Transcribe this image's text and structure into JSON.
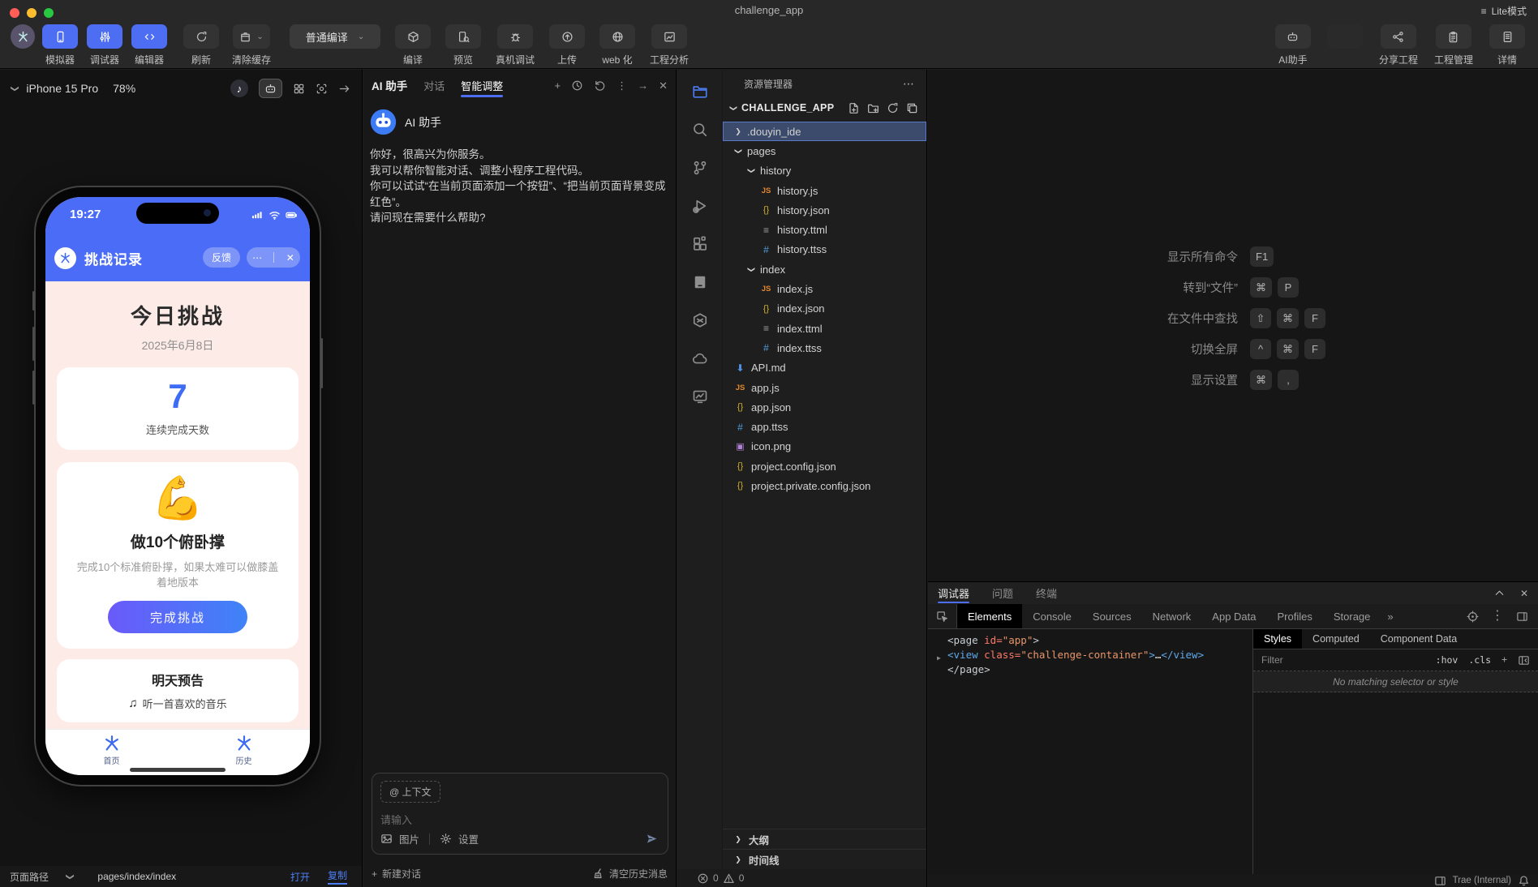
{
  "window": {
    "title": "challenge_app",
    "lite_mode": "Lite模式"
  },
  "toolbar": {
    "primary": [
      {
        "label": "模拟器",
        "icon": "phone"
      },
      {
        "label": "调试器",
        "icon": "sliders"
      },
      {
        "label": "编辑器",
        "icon": "code"
      }
    ],
    "secondary": [
      {
        "label": "刷新",
        "icon": "refresh",
        "caret": false
      },
      {
        "label": "清除缓存",
        "icon": "clear",
        "caret": true
      }
    ],
    "compile_select": "普通编译",
    "actions": [
      {
        "label": "编译",
        "icon": "box"
      },
      {
        "label": "预览",
        "icon": "preview"
      },
      {
        "label": "真机调试",
        "icon": "bug"
      },
      {
        "label": "上传",
        "icon": "upload"
      },
      {
        "label": "web 化",
        "icon": "globe"
      },
      {
        "label": "工程分析",
        "icon": "analysis"
      }
    ],
    "right_actions": [
      {
        "label": "AI助手",
        "icon": "robot",
        "disabled": false
      },
      {
        "label": "",
        "icon": "blank",
        "disabled": true
      },
      {
        "label": "分享工程",
        "icon": "share",
        "disabled": false
      },
      {
        "label": "工程管理",
        "icon": "clipboard",
        "disabled": false
      },
      {
        "label": "详情",
        "icon": "doc",
        "disabled": false
      }
    ]
  },
  "simulator": {
    "device": "iPhone 15 Pro",
    "zoom": "78%",
    "footer": {
      "label": "页面路径",
      "path": "pages/index/index",
      "open": "打开",
      "copy": "复制"
    },
    "phone": {
      "time": "19:27",
      "app_title": "挑战记录",
      "feedback": "反馈",
      "heading": "今日挑战",
      "date": "2025年6月8日",
      "streak_value": "7",
      "streak_label": "连续完成天数",
      "challenge_emoji": "💪",
      "challenge_title": "做10个俯卧撑",
      "challenge_desc": "完成10个标准俯卧撑，如果太难可以做膝盖着地版本",
      "complete_button": "完成挑战",
      "tomorrow_title": "明天预告",
      "tomorrow_desc": "听一首喜欢的音乐",
      "tabs": [
        {
          "label": "首页"
        },
        {
          "label": "历史"
        }
      ]
    }
  },
  "ai_panel": {
    "title": "AI 助手",
    "tab_chat": "对话",
    "tab_smart": "智能调整",
    "assistant_name": "AI 助手",
    "message": "你好，很高兴为你服务。\n我可以帮你智能对话、调整小程序工程代码。\n你可以试试“在当前页面添加一个按钮”、“把当前页面背景变成红色”。\n请问现在需要什么帮助?",
    "context_chip": "@ 上下文",
    "input_placeholder": "请输入",
    "image_button": "图片",
    "settings_button": "设置",
    "new_chat": "新建对话",
    "clear_history": "清空历史消息"
  },
  "explorer": {
    "title": "资源管理器",
    "project": "CHALLENGE_APP",
    "activity_bar": [
      "files",
      "search",
      "source-control",
      "run-debug",
      "extensions",
      "notebook",
      "package",
      "cloud",
      "monitor"
    ],
    "tree": [
      {
        "level": 1,
        "kind": "folder",
        "chevron": "right",
        "label": ".douyin_ide",
        "selected": true
      },
      {
        "level": 1,
        "kind": "folder",
        "chevron": "down",
        "label": "pages",
        "selected": false
      },
      {
        "level": 2,
        "kind": "folder",
        "chevron": "down",
        "label": "history",
        "selected": false
      },
      {
        "level": 3,
        "kind": "js",
        "label": "history.js",
        "selected": false
      },
      {
        "level": 3,
        "kind": "json",
        "label": "history.json",
        "selected": false
      },
      {
        "level": 3,
        "kind": "ttml",
        "label": "history.ttml",
        "selected": false
      },
      {
        "level": 3,
        "kind": "ttss",
        "label": "history.ttss",
        "selected": false
      },
      {
        "level": 2,
        "kind": "folder",
        "chevron": "down",
        "label": "index",
        "selected": false
      },
      {
        "level": 3,
        "kind": "js",
        "label": "index.js",
        "selected": false
      },
      {
        "level": 3,
        "kind": "json",
        "label": "index.json",
        "selected": false
      },
      {
        "level": 3,
        "kind": "ttml",
        "label": "index.ttml",
        "selected": false
      },
      {
        "level": 3,
        "kind": "ttss",
        "label": "index.ttss",
        "selected": false
      },
      {
        "level": 1,
        "kind": "md",
        "label": "API.md",
        "selected": false
      },
      {
        "level": 1,
        "kind": "js",
        "label": "app.js",
        "selected": false
      },
      {
        "level": 1,
        "kind": "json",
        "label": "app.json",
        "selected": false
      },
      {
        "level": 1,
        "kind": "ttss",
        "label": "app.ttss",
        "selected": false
      },
      {
        "level": 1,
        "kind": "img",
        "label": "icon.png",
        "selected": false
      },
      {
        "level": 1,
        "kind": "json",
        "label": "project.config.json",
        "selected": false
      },
      {
        "level": 1,
        "kind": "json",
        "label": "project.private.config.json",
        "selected": false
      }
    ],
    "outline": "大纲",
    "timeline": "时间线"
  },
  "editor": {
    "shortcuts": [
      {
        "label": "显示所有命令",
        "keys": [
          "F1"
        ]
      },
      {
        "label": "转到“文件”",
        "keys": [
          "⌘",
          "P"
        ]
      },
      {
        "label": "在文件中查找",
        "keys": [
          "⇧",
          "⌘",
          "F"
        ]
      },
      {
        "label": "切换全屏",
        "keys": [
          "^",
          "⌘",
          "F"
        ]
      },
      {
        "label": "显示设置",
        "keys": [
          "⌘",
          ","
        ]
      }
    ]
  },
  "debugger": {
    "tabs": [
      "调试器",
      "问题",
      "终端"
    ],
    "active_tab": "调试器",
    "devtools_tabs": [
      "Elements",
      "Console",
      "Sources",
      "Network",
      "App Data",
      "Profiles",
      "Storage"
    ],
    "active_devtools_tab": "Elements",
    "overflow_glyph": "»",
    "code": [
      {
        "arrow": false,
        "tokens": [
          [
            "tagp",
            "<page "
          ],
          [
            "attr",
            "id="
          ],
          [
            "val",
            "\"app\""
          ],
          [
            "tagp",
            ">"
          ]
        ]
      },
      {
        "arrow": true,
        "tokens": [
          [
            "tag",
            "<view "
          ],
          [
            "attr",
            "class="
          ],
          [
            "val",
            "\"challenge-container\""
          ],
          [
            "tag",
            ">"
          ],
          [
            "plain",
            "…"
          ],
          [
            "tag",
            "</view>"
          ]
        ]
      },
      {
        "arrow": false,
        "tokens": [
          [
            "tagp",
            "</page>"
          ]
        ]
      }
    ],
    "styles_tabs": [
      "Styles",
      "Computed",
      "Component Data"
    ],
    "active_styles_tab": "Styles",
    "filter_placeholder": "Filter",
    "pseudo": ":hov",
    "cls": ".cls",
    "empty_message": "No matching selector or style"
  },
  "status_bar": {
    "errors": "0",
    "warnings": "0",
    "environment": "Trae (Internal)"
  },
  "glyphs": {
    "more-v": "⋮",
    "more-h": "⋯",
    "plus": "+",
    "arrow-right-sm": "→",
    "close": "✕",
    "chevron": "❯",
    "note": "♪",
    "music": "♫",
    "lite": "≡",
    "overflow": "»"
  },
  "colors": {
    "accent": "#4d6df2",
    "phone_blue": "#4b6cf6",
    "phone_pink": "#fcebe7",
    "gradient_start": "#6a5af9",
    "gradient_end": "#3f83f8",
    "selected_row": "#3c4a6b"
  }
}
